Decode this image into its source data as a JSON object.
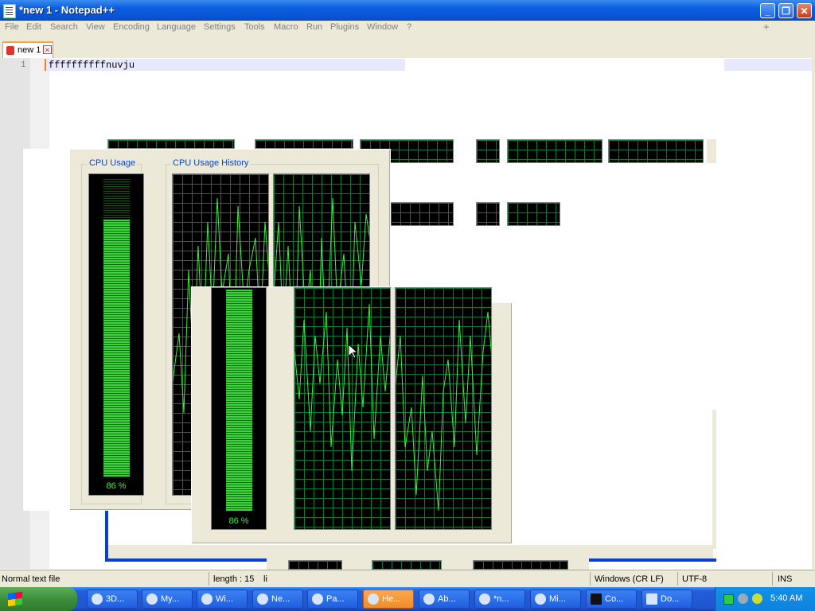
{
  "window": {
    "title": "*new 1 - Notepad++",
    "controls": {
      "minimize": "_",
      "restore": "❐",
      "close": "✕"
    }
  },
  "menu": {
    "items": [
      "File",
      "Edit",
      "Search",
      "View",
      "Encoding",
      "Language",
      "Settings",
      "Tools",
      "Macro",
      "Run",
      "Plugins",
      "Window",
      "?"
    ],
    "plus": "+"
  },
  "tabs": [
    {
      "label": "new 1"
    }
  ],
  "editor": {
    "line_number": "1",
    "text": "ffffffffffnuvju"
  },
  "statusbar": {
    "type": "Normal text file",
    "length": "length : 15",
    "lines_fragment": "li",
    "eol": "Windows (CR LF)",
    "encoding": "UTF-8",
    "mode": "INS"
  },
  "taskmgr": {
    "cpu_usage_label": "CPU Usage",
    "cpu_history_label": "CPU Usage History",
    "cpu_percent": "86 %",
    "cpu_fraction": 0.86
  },
  "taskbar": {
    "items": [
      {
        "label": "3D...",
        "icon": "globe-icon"
      },
      {
        "label": "My...",
        "icon": "computer-icon"
      },
      {
        "label": "Wi...",
        "icon": "window-icon"
      },
      {
        "label": "Ne...",
        "icon": "network-icon"
      },
      {
        "label": "Pa...",
        "icon": "paint-icon"
      },
      {
        "label": "He...",
        "icon": "help-icon",
        "active": true
      },
      {
        "label": "Ab...",
        "icon": "window-icon"
      },
      {
        "label": "*n...",
        "icon": "notepad-icon"
      },
      {
        "label": "Mi...",
        "icon": "gear-icon"
      },
      {
        "label": "Co...",
        "icon": "console-icon"
      },
      {
        "label": "Do...",
        "icon": "document-icon"
      }
    ],
    "clock": "5:40 AM"
  }
}
